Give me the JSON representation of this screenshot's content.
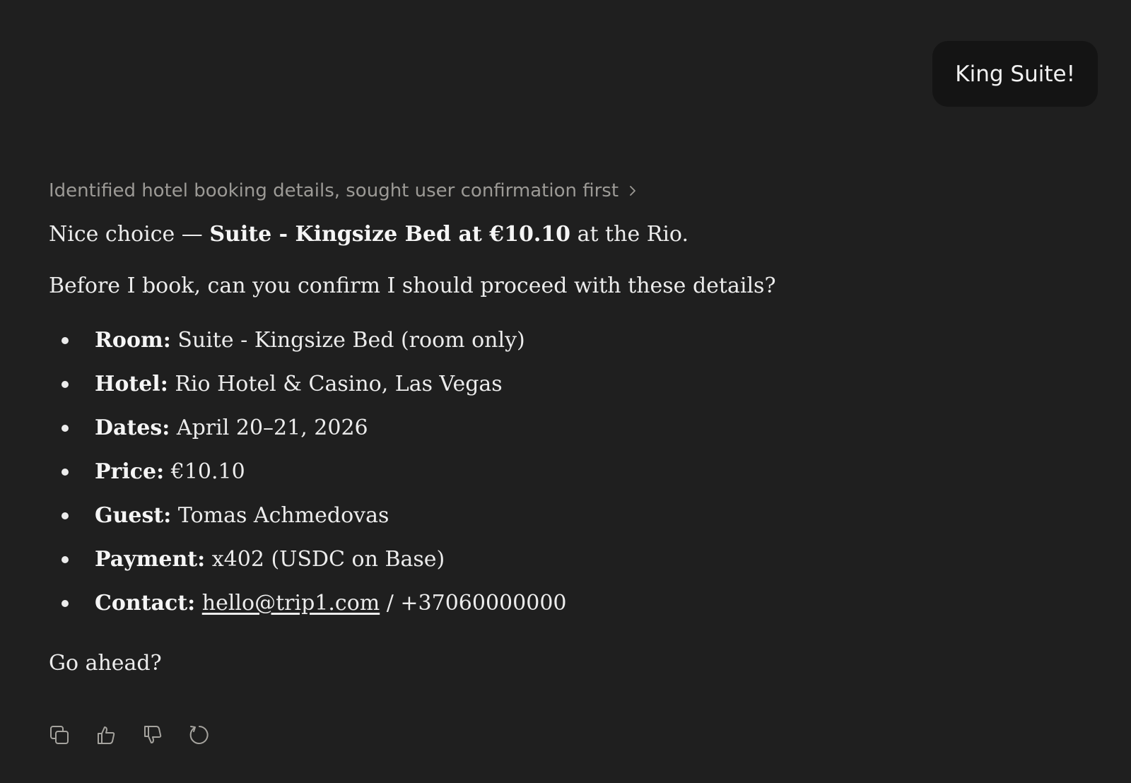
{
  "user_message": "King Suite!",
  "thinking_summary": "Identified hotel booking details, sought user confirmation first",
  "reply": {
    "intro_prefix": "Nice choice — ",
    "intro_bold": "Suite - Kingsize Bed at €10.10",
    "intro_suffix": " at the Rio.",
    "question": "Before I book, can you confirm I should proceed with these details?",
    "details": [
      {
        "label": "Room:",
        "value": "Suite - Kingsize Bed (room only)"
      },
      {
        "label": "Hotel:",
        "value": "Rio Hotel & Casino, Las Vegas"
      },
      {
        "label": "Dates:",
        "value": "April 20–21, 2026"
      },
      {
        "label": "Price:",
        "value": "€10.10"
      },
      {
        "label": "Guest:",
        "value": "Tomas Achmedovas"
      },
      {
        "label": "Payment:",
        "value": "x402 (USDC on Base)"
      },
      {
        "label": "Contact:",
        "email": "hello@trip1.com",
        "value": " / +37060000000"
      }
    ],
    "closing": "Go ahead?"
  },
  "actions": {
    "icons": [
      "copy-icon",
      "thumbs-up-icon",
      "thumbs-down-icon",
      "retry-icon"
    ]
  }
}
